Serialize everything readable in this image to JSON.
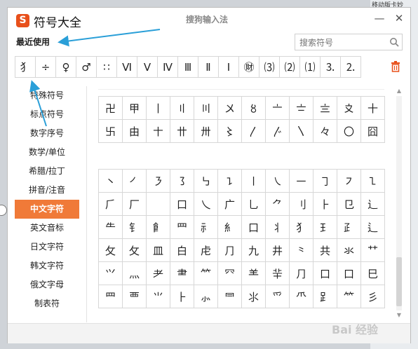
{
  "background": {
    "tab_text": "移动版卡妙"
  },
  "window": {
    "app_title": "符号大全",
    "center_title": "搜狗输入法",
    "logo_glyph": "S",
    "minimize_label": "—",
    "close_label": "✕",
    "accent_color": "#f07a38"
  },
  "recent": {
    "label": "最近使用",
    "symbols": [
      "⺨",
      "÷",
      "♀",
      "♂",
      "∷",
      "Ⅵ",
      "Ⅴ",
      "Ⅳ",
      "Ⅲ",
      "Ⅱ",
      "Ⅰ",
      "㊖",
      "⑶",
      "⑵",
      "⑴",
      "⒊",
      "⒉"
    ]
  },
  "search": {
    "placeholder": "搜索符号"
  },
  "sidebar": {
    "items": [
      {
        "label": "特殊符号"
      },
      {
        "label": "标点符号"
      },
      {
        "label": "数字序号"
      },
      {
        "label": "数学/单位"
      },
      {
        "label": "希腊/拉丁"
      },
      {
        "label": "拼音/注音"
      },
      {
        "label": "中文字符",
        "active": true
      },
      {
        "label": "英文音标"
      },
      {
        "label": "日文字符"
      },
      {
        "label": "韩文字符"
      },
      {
        "label": "俄文字母"
      },
      {
        "label": "制表符"
      }
    ]
  },
  "grid1": [
    [
      "卍",
      "甲",
      "丨",
      "〢",
      "〣",
      "〤",
      "〥",
      "〦",
      "〧",
      "〨",
      "〩",
      "十"
    ],
    [
      "卐",
      "由",
      "〸",
      "〹",
      "〺",
      "〻",
      "〳",
      "〴",
      "〵",
      "々",
      "〇",
      "囧"
    ]
  ],
  "grid2": [
    [
      "㇔",
      "㇒",
      "㇋",
      "㇌",
      "㇉",
      "㇊",
      "㇑",
      "㇏",
      "㇐",
      "㇆",
      "㇇",
      "㇅"
    ],
    [
      "⺁",
      "厂",
      "",
      "口",
      "乀",
      "广",
      "⺃",
      "⺈",
      "⺉",
      "⺊",
      "⺋",
      "⻌"
    ],
    [
      "⺧",
      "⻐",
      "⻞",
      "⺫",
      "⺬",
      "⺯",
      "口",
      "⺦",
      "⺨",
      "⺩",
      "⺪",
      "⻍"
    ],
    [
      "⺙",
      "攵",
      "皿",
      "白",
      "虍",
      "⺆",
      "九",
      "井",
      "⺀",
      "共",
      "氺",
      "⺿"
    ],
    [
      "⺍",
      "⺣",
      "⺹",
      "⺻",
      "⺮",
      "⺳",
      "⺷",
      "⺸",
      "⺆",
      "口",
      "口",
      "⺒"
    ],
    [
      "⺲",
      "覀",
      "⺌",
      "⺊",
      "⺗",
      "⺜",
      "⺢",
      "⺤",
      "⺥",
      "⻊",
      "⺮",
      "彡"
    ]
  ],
  "watermark": "Bai 经验"
}
